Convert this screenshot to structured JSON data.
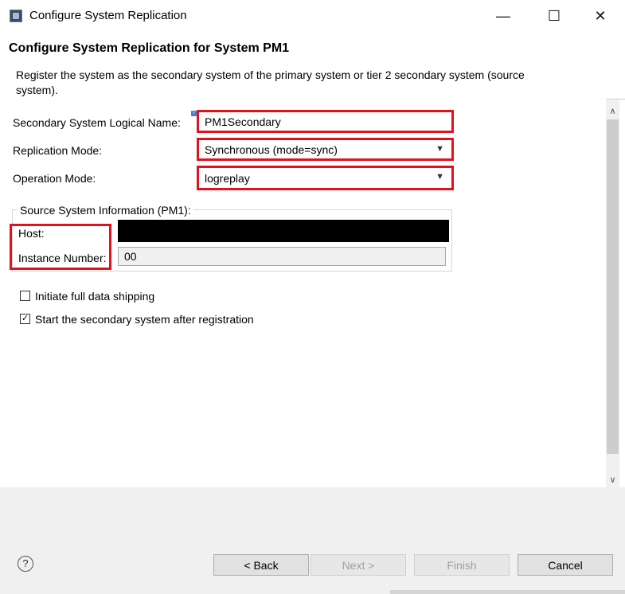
{
  "window": {
    "title": "Configure System Replication",
    "minimize_glyph": "—",
    "maximize_glyph": "☐",
    "close_glyph": "✕"
  },
  "header": {
    "title": "Configure System Replication for System PM1",
    "description": "Register the system as the secondary system of the primary system or tier 2 secondary system (source system)."
  },
  "form": {
    "logical_name_label": "Secondary System Logical Name:",
    "logical_name_value": "PM1Secondary",
    "info_icon": "i",
    "replication_mode_label": "Replication Mode:",
    "replication_mode_value": "Synchronous (mode=sync)",
    "operation_mode_label": "Operation Mode:",
    "operation_mode_value": "logreplay",
    "source_group_title": "Source System Information (PM1):",
    "host_label": "Host:",
    "instance_label": "Instance Number:",
    "instance_value": "00",
    "full_shipping_label": "Initiate full data shipping",
    "full_shipping_checked": false,
    "start_secondary_label": "Start the secondary system after registration",
    "start_secondary_checked": true
  },
  "footer": {
    "help": "?",
    "back": "< Back",
    "next": "Next >",
    "finish": "Finish",
    "cancel": "Cancel"
  },
  "scroll": {
    "up": "∧",
    "down": "∨"
  },
  "highlight_color": "#e0121e"
}
